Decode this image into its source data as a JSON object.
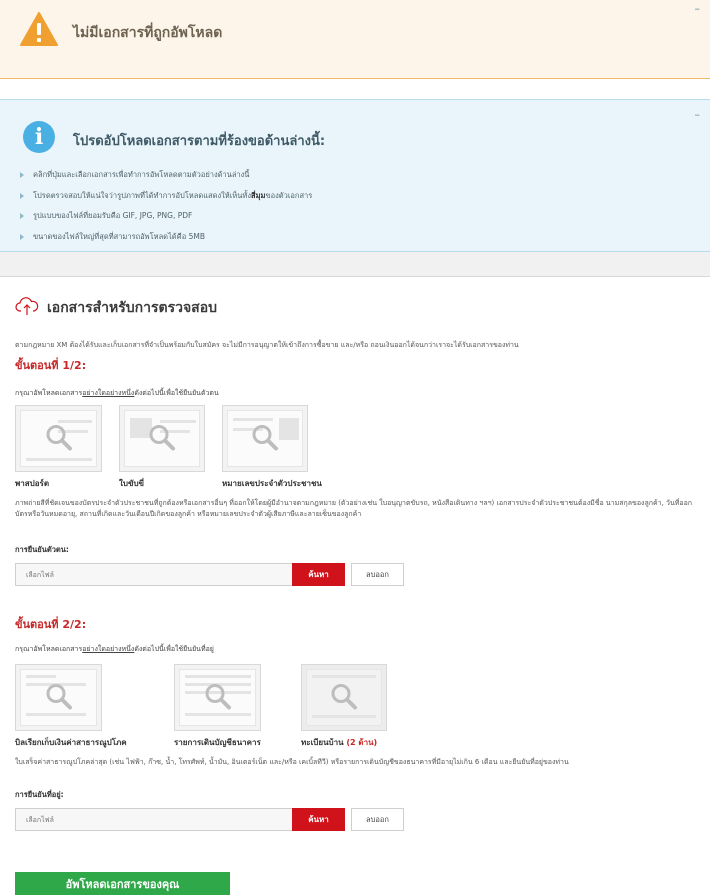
{
  "warning": {
    "text": "ไม่มีเอกสารที่ถูกอัพโหลด",
    "collapse": "–"
  },
  "info": {
    "title": "โปรดอัปโหลดเอกสารตามที่ร้องขอด้านล่างนี้:",
    "collapse": "–",
    "items": [
      "คลิกที่ปุ่มและเลือกเอกสารเพื่อทำการอัพโหลดตามตัวอย่างด้านล่างนี้",
      "โปรดตรวจสอบให้แน่ใจว่ารูปภาพที่ได้ทำการอัปโหลดแสดงให้เห็นทั้ง",
      "รูปแบบของไฟล์ที่ยอมรับคือ GIF, JPG, PNG, PDF",
      "ขนาดของไฟล์ใหญ่ที่สุดที่สามารถอัพโหลดได้คือ 5MB"
    ],
    "item2_bold": "สี่มุม",
    "item2_tail": "ของตัวเอกสาร"
  },
  "section": {
    "title": "เอกสารสำหรับการตรวจสอบ",
    "desc": "ตามกฎหมาย XM ต้องได้รับและเก็บเอกสารที่จำเป็นพร้อมกับใบสมัคร จะไม่มีการอนุญาตให้เข้าถึงการซื้อขาย และ/หรือ ถอนเงินออกได้จนกว่าเราจะได้รับเอกสารของท่าน"
  },
  "step1": {
    "title": "ขั้นตอนที่ 1/2:",
    "instr_pre": "กรุณาอัพโหลดเอกสาร",
    "instr_u": "อย่างใดอย่างหนึ่ง",
    "instr_post": "ดังต่อไปนี้เพื่อใช้ยืนยันตัวตน",
    "docs": [
      "พาสปอร์ต",
      "ใบขับขี่",
      "หมายเลขประจำตัวประชาชน"
    ],
    "para": "ภาพถ่ายสีที่ชัดเจนของบัตรประจำตัวประชาชนที่ถูกต้องหรือเอกสารอื่นๆ ที่ออกให้โดยผู้มีอำนาจตามกฎหมาย (ตัวอย่างเช่น ใบอนุญาตขับรถ, หนังสือเดินทาง ฯลฯ) เอกสารประจำตัวประชาชนต้องมีชื่อ นามสกุลของลูกค้า, วันที่ออกบัตรหรือวันหมดอายุ, สถานที่เกิดและวันเดือนปีเกิดของลูกค้า หรือหมายเลขประจำตัวผู้เสียภาษีและลายเซ็นของลูกค้า",
    "field_label": "การยืนยันตัวตน:",
    "placeholder": "เลือกไฟล์",
    "browse": "ค้นหา",
    "remove": "ลบออก"
  },
  "step2": {
    "title": "ขั้นตอนที่ 2/2:",
    "instr_pre": "กรุณาอัพโหลดเอกสาร",
    "instr_u": "อย่างใดอย่างหนึ่ง",
    "instr_post": "ดังต่อไปนี้เพื่อใช้ยืนยันที่อยู่",
    "docs": [
      "บิลเรียกเก็บเงินค่าสาธารณูปโภค",
      "รายการเดินบัญชีธนาคาร",
      "ทะเบียนบ้าน"
    ],
    "doc3_extra": "(2 ด้าน)",
    "para": "ใบเสร็จค่าสาธารณูปโภคล่าสุด (เช่น ไฟฟ้า, ก๊าซ, น้ำ, โทรศัพท์, น้ำมัน, อินเตอร์เน็ต และ/หรือ เคเบิ้ลทีวี) หรือรายการเดินบัญชีของธนาคารที่มีอายุไม่เกิน 6 เดือน และยืนยันที่อยู่ของท่าน",
    "field_label": "การยืนยันที่อยู่:",
    "placeholder": "เลือกไฟล์",
    "browse": "ค้นหา",
    "remove": "ลบออก"
  },
  "submit": "อัพโหลดเอกสารของคุณ",
  "colors": {
    "accent_red": "#d0121a",
    "green": "#2fa84a",
    "info_blue": "#4ab0e3",
    "warn_orange": "#f0a030"
  }
}
